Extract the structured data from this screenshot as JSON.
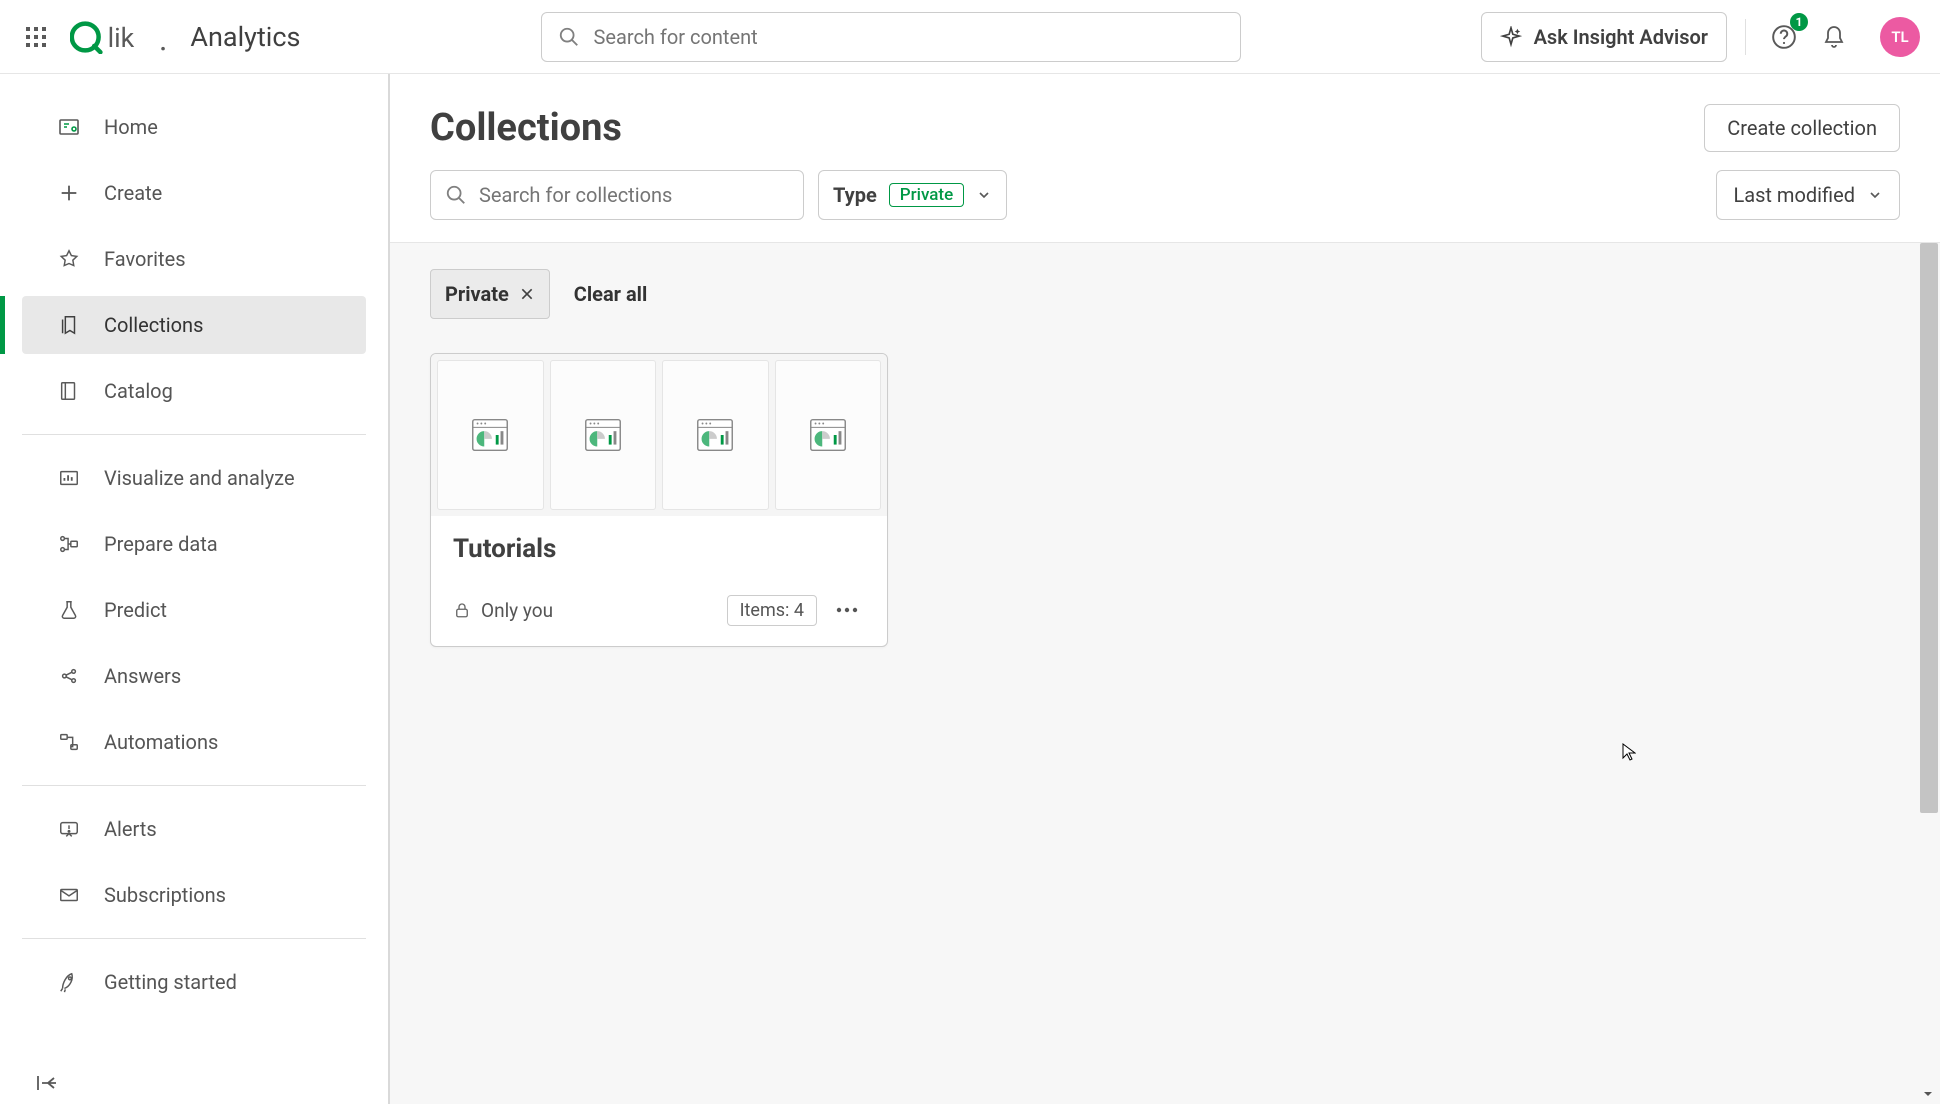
{
  "header": {
    "app_title": "Analytics",
    "search_placeholder": "Search for content",
    "ask_label": "Ask Insight Advisor",
    "help_badge": "1",
    "avatar_initials": "TL"
  },
  "sidebar": {
    "items": [
      {
        "label": "Home"
      },
      {
        "label": "Create"
      },
      {
        "label": "Favorites"
      },
      {
        "label": "Collections"
      },
      {
        "label": "Catalog"
      },
      {
        "label": "Visualize and analyze"
      },
      {
        "label": "Prepare data"
      },
      {
        "label": "Predict"
      },
      {
        "label": "Answers"
      },
      {
        "label": "Automations"
      },
      {
        "label": "Alerts"
      },
      {
        "label": "Subscriptions"
      },
      {
        "label": "Getting started"
      }
    ]
  },
  "page": {
    "title": "Collections",
    "create_label": "Create collection"
  },
  "filters": {
    "search_placeholder": "Search for collections",
    "type_label": "Type",
    "type_value": "Private",
    "sort_label": "Last modified"
  },
  "chips": {
    "private": "Private",
    "clear": "Clear all"
  },
  "card": {
    "title": "Tutorials",
    "visibility": "Only you",
    "items": "Items: 4"
  }
}
